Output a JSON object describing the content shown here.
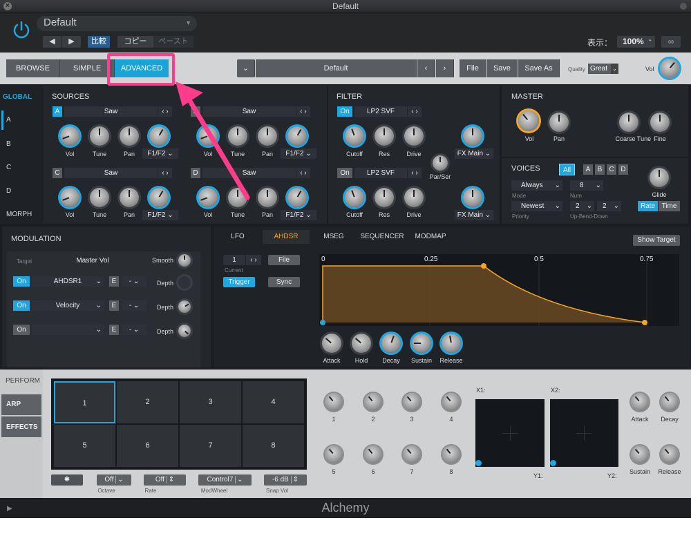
{
  "window": {
    "title": "Default",
    "footer_title": "Alchemy"
  },
  "header": {
    "preset_name": "Default",
    "compare_label": "比較",
    "copy_label": "コピー",
    "paste_label": "ペースト",
    "view_label": "表示：",
    "zoom": "100%"
  },
  "toolbar": {
    "browse": "BROWSE",
    "simple": "SIMPLE",
    "advanced": "ADVANCED",
    "preset": "Default",
    "file": "File",
    "save": "Save",
    "save_as": "Save As",
    "quality_label": "Quality",
    "quality_value": "Great",
    "vol_label": "Vol"
  },
  "side_tabs": [
    "GLOBAL",
    "A",
    "B",
    "C",
    "D",
    "MORPH"
  ],
  "sources": {
    "title": "SOURCES",
    "units": [
      {
        "letter": "A",
        "wave": "Saw",
        "route": "F1/F2"
      },
      {
        "letter": "B",
        "wave": "Saw",
        "route": "F1/F2"
      },
      {
        "letter": "C",
        "wave": "Saw",
        "route": "F1/F2"
      },
      {
        "letter": "D",
        "wave": "Saw",
        "route": "F1/F2"
      }
    ],
    "knob_labels": [
      "Vol",
      "Tune",
      "Pan"
    ]
  },
  "filter": {
    "title": "FILTER",
    "on_label": "On",
    "units": [
      {
        "type": "LP2 SVF",
        "fx": "FX Main"
      },
      {
        "type": "LP2 SVF",
        "fx": "FX Main"
      }
    ],
    "knob_labels": [
      "Cutoff",
      "Res",
      "Drive"
    ],
    "par_ser": "Par/Ser"
  },
  "master": {
    "title": "MASTER",
    "knob_labels": [
      "Vol",
      "Pan",
      "Coarse",
      "Tune",
      "Fine"
    ]
  },
  "voices": {
    "title": "VOICES",
    "all": "All",
    "letters": [
      "A",
      "B",
      "C",
      "D"
    ],
    "mode_value": "Always",
    "mode_label": "Mode",
    "num_value": "8",
    "num_label": "Num",
    "priority_value": "Newest",
    "priority_label": "Priority",
    "bend_up": "2",
    "bend_down": "2",
    "bend_label": "Up-Bend-Down",
    "glide_label": "Glide",
    "rate": "Rate",
    "time": "Time"
  },
  "modulation": {
    "title": "MODULATION",
    "target_label": "Target",
    "target_value": "Master Vol",
    "smooth_label": "Smooth",
    "rows": [
      {
        "on": "On",
        "source": "AHDSR1",
        "e": "E",
        "dash": "-",
        "depth": "Depth"
      },
      {
        "on": "On",
        "source": "Velocity",
        "e": "E",
        "dash": "-",
        "depth": "Depth"
      },
      {
        "on": "On",
        "source": "",
        "e": "E",
        "dash": "-",
        "depth": "Depth"
      }
    ]
  },
  "mod_tabs": [
    "LFO",
    "AHDSR",
    "MSEG",
    "SEQUENCER",
    "MODMAP"
  ],
  "show_target": "Show Target",
  "ahdsr": {
    "index": "1",
    "current_label": "Current",
    "file": "File",
    "trigger": "Trigger",
    "sync": "Sync",
    "ticks": [
      "0",
      "0.25",
      "0.5",
      "0.75"
    ],
    "knob_labels": [
      "Attack",
      "Hold",
      "Decay",
      "Sustain",
      "Release"
    ]
  },
  "perform": {
    "side_tabs": [
      "PERFORM",
      "ARP",
      "EFFECTS"
    ],
    "pads": [
      "1",
      "2",
      "3",
      "4",
      "5",
      "6",
      "7",
      "8"
    ],
    "octave_value": "Off",
    "octave_label": "Octave",
    "rate_value": "Off",
    "rate_label": "Rate",
    "modwheel_value": "Control7",
    "modwheel_label": "ModWheel",
    "snap_value": "-6 dB",
    "snap_label": "Snap Vol",
    "knob_labels": [
      "1",
      "2",
      "3",
      "4",
      "5",
      "6",
      "7",
      "8"
    ],
    "x1": "X1:",
    "x2": "X2:",
    "y1": "Y1:",
    "y2": "Y2:",
    "env_labels": [
      "Attack",
      "Decay",
      "Sustain",
      "Release"
    ]
  },
  "colors": {
    "accent": "#1ea7e0",
    "highlight": "#ff3b8c",
    "envelope": "#f5a623"
  }
}
